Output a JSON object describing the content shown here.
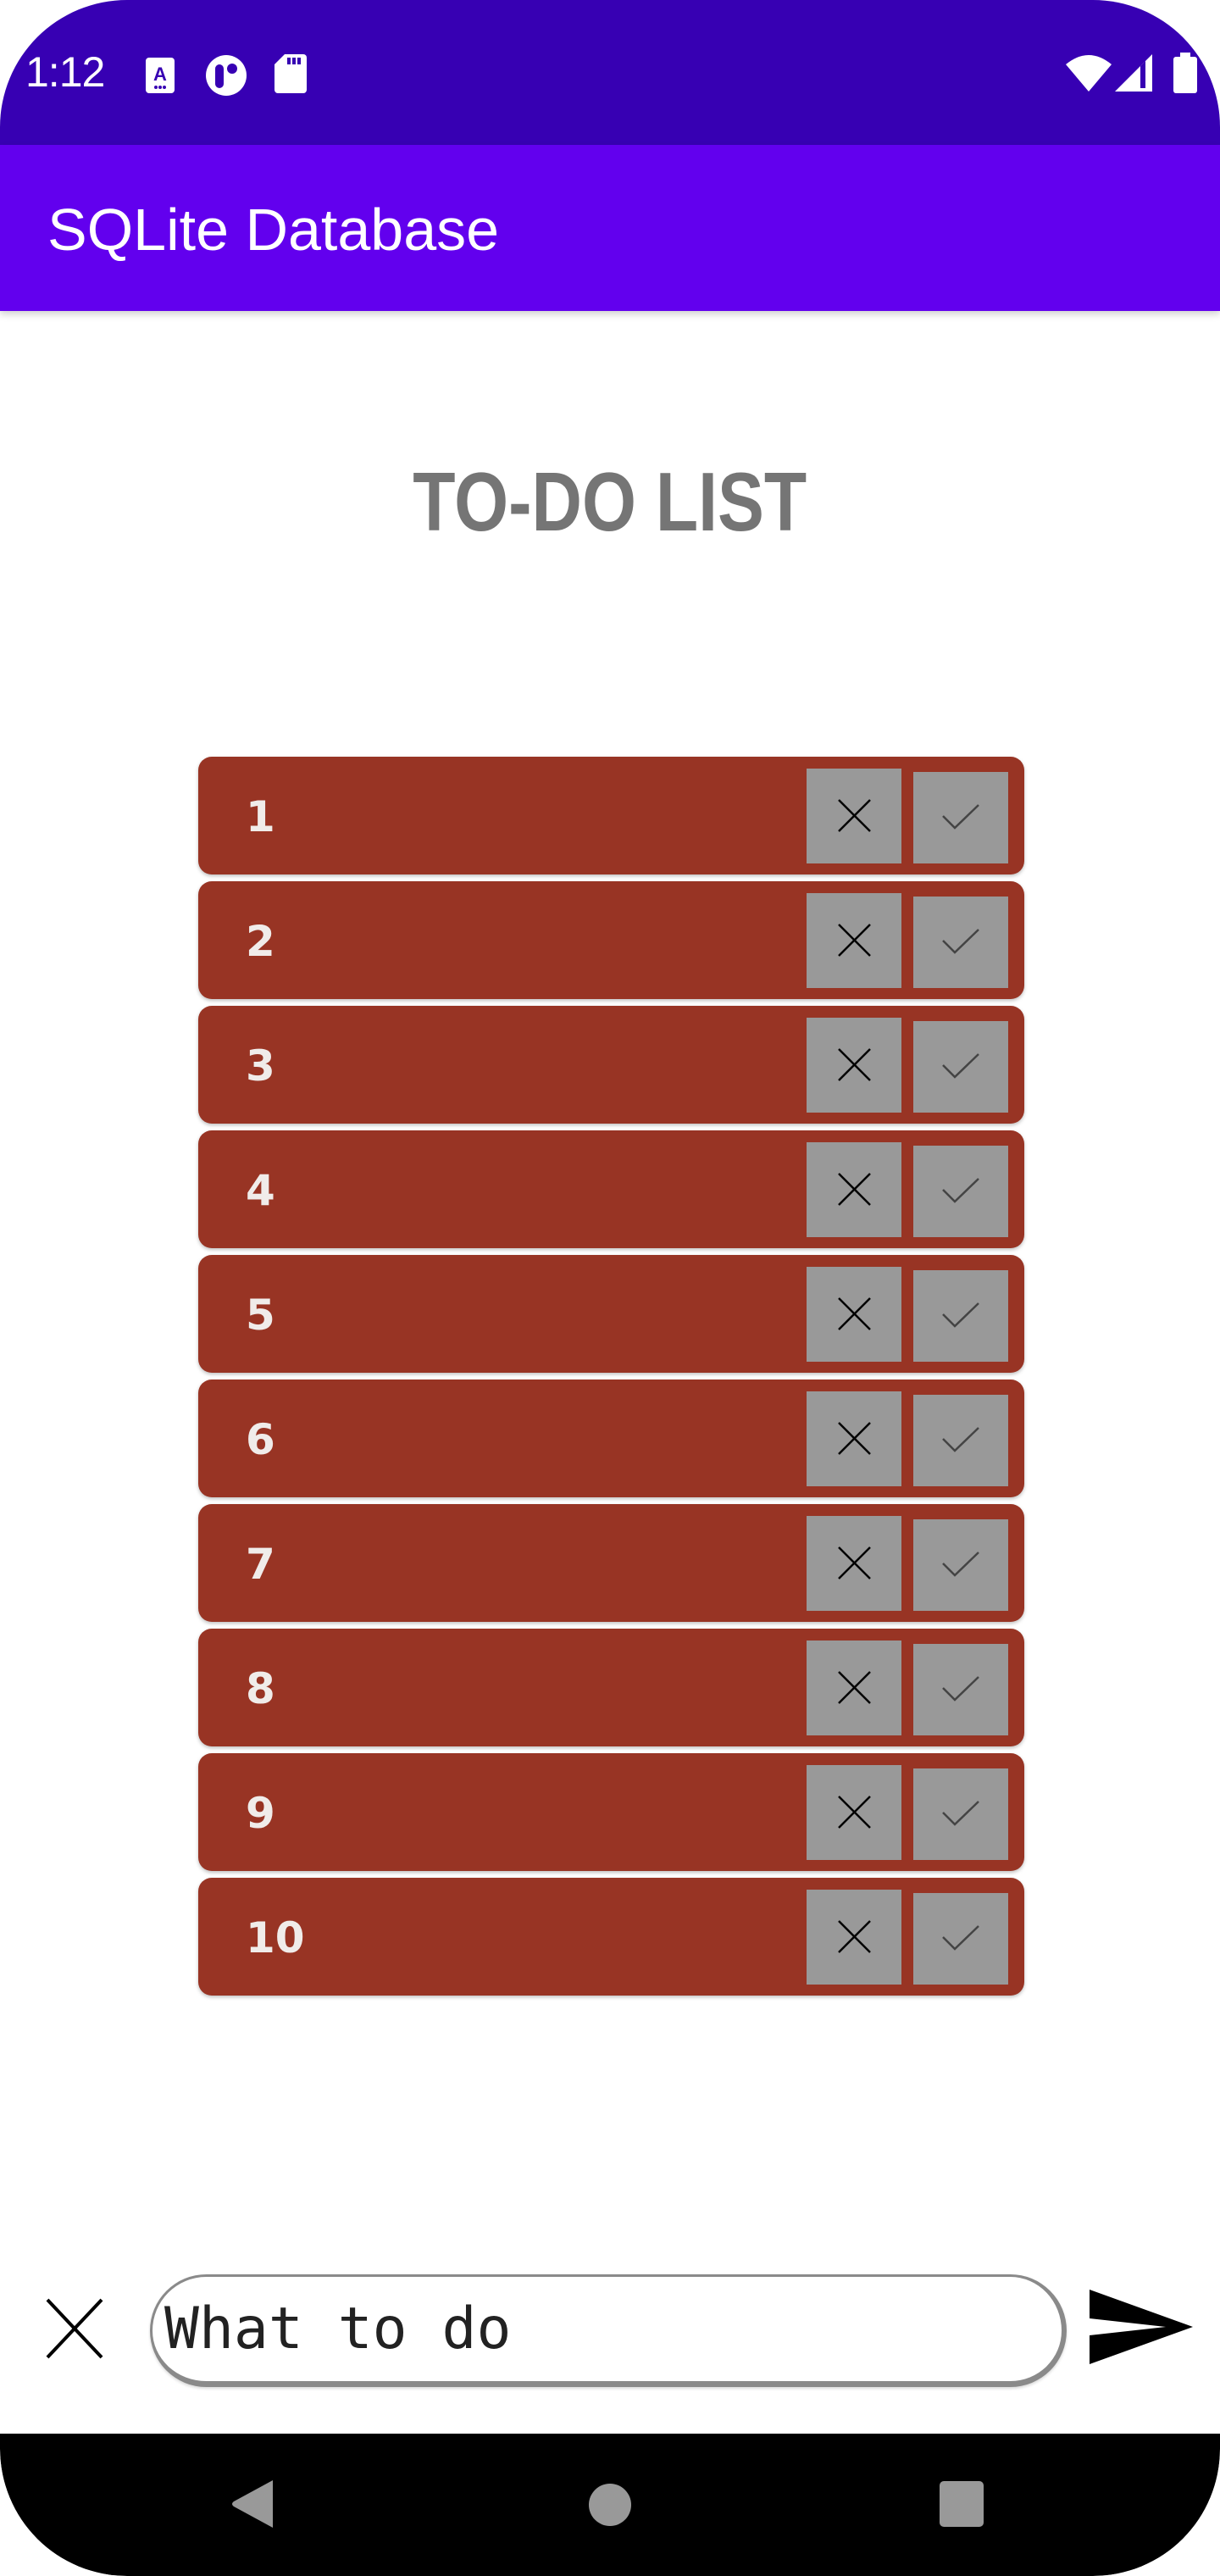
{
  "status_bar": {
    "time": "1:12",
    "left_icons": [
      "accessibility-a-icon",
      "circle-app-icon",
      "sd-card-icon"
    ],
    "right_icons": [
      "wifi-icon",
      "cell-signal-icon",
      "battery-icon"
    ]
  },
  "app_bar": {
    "title": "SQLite Database"
  },
  "page": {
    "heading": "TO-DO LIST"
  },
  "todos": [
    {
      "label": "1",
      "delete_icon": "close-icon",
      "done_icon": "check-icon"
    },
    {
      "label": "2",
      "delete_icon": "close-icon",
      "done_icon": "check-icon"
    },
    {
      "label": "3",
      "delete_icon": "close-icon",
      "done_icon": "check-icon"
    },
    {
      "label": "4",
      "delete_icon": "close-icon",
      "done_icon": "check-icon"
    },
    {
      "label": "5",
      "delete_icon": "close-icon",
      "done_icon": "check-icon"
    },
    {
      "label": "6",
      "delete_icon": "close-icon",
      "done_icon": "check-icon"
    },
    {
      "label": "7",
      "delete_icon": "close-icon",
      "done_icon": "check-icon"
    },
    {
      "label": "8",
      "delete_icon": "close-icon",
      "done_icon": "check-icon"
    },
    {
      "label": "9",
      "delete_icon": "close-icon",
      "done_icon": "check-icon"
    },
    {
      "label": "10",
      "delete_icon": "close-icon",
      "done_icon": "check-icon"
    }
  ],
  "input_bar": {
    "clear_icon": "close-icon",
    "value": "",
    "placeholder": "What to do",
    "send_icon": "send-icon"
  },
  "nav_bar": {
    "buttons": [
      "back-icon",
      "home-icon",
      "recents-icon"
    ]
  },
  "colors": {
    "status_bar": "#3700B3",
    "app_bar": "#6200EE",
    "heading": "#757575",
    "row_bg": "#983424",
    "row_button": "#999999",
    "row_text": "#F0ECEA"
  }
}
